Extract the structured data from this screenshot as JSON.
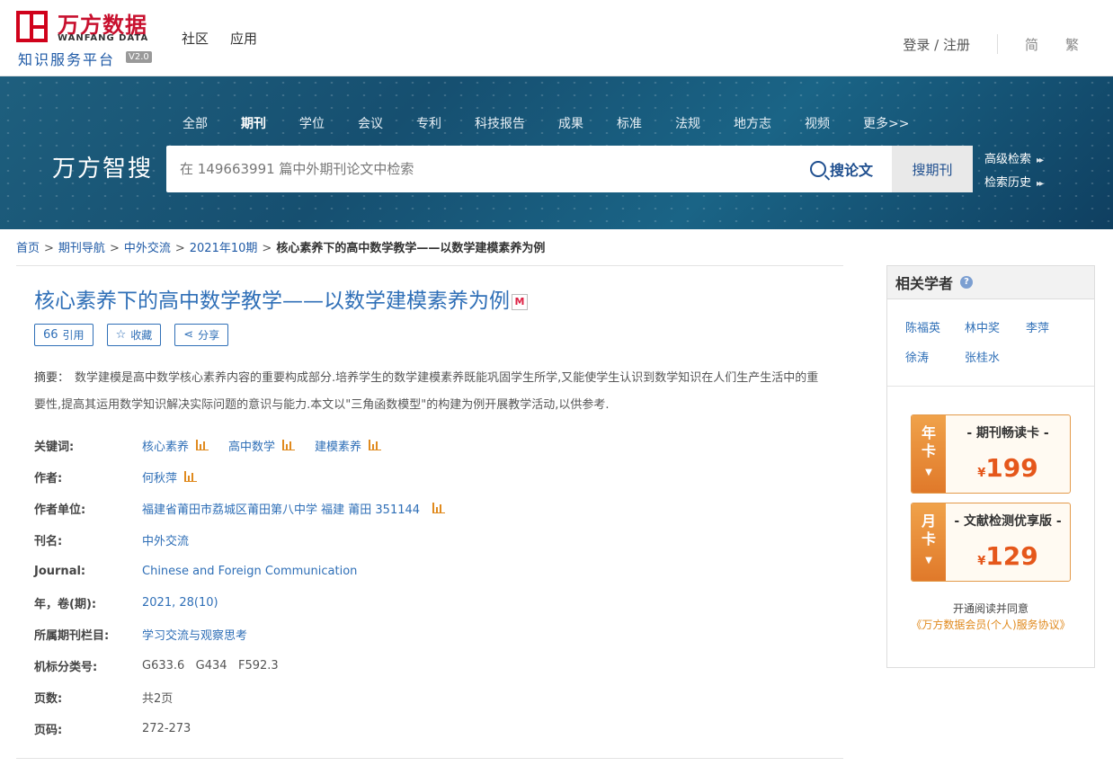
{
  "header": {
    "logo_cn": "万方数据",
    "logo_en": "WANFANG DATA",
    "logo_sub": "知识服务平台",
    "version": "V2.0",
    "nav": [
      "社区",
      "应用"
    ],
    "login": "登录 / 注册",
    "lang_simplified": "简",
    "lang_traditional": "繁"
  },
  "banner": {
    "categories": [
      "全部",
      "期刊",
      "学位",
      "会议",
      "专利",
      "科技报告",
      "成果",
      "标准",
      "法规",
      "地方志",
      "视频",
      "更多>>"
    ],
    "active_category": "期刊",
    "brand": "万方智搜",
    "search_placeholder": "在 149663991 篇中外期刊论文中检索",
    "search_paper": "搜论文",
    "search_journal": "搜期刊",
    "advanced": "高级检索",
    "history": "检索历史"
  },
  "breadcrumb": {
    "items": [
      "首页",
      "期刊导航",
      "中外交流",
      "2021年10期"
    ],
    "current": "核心素养下的高中数学教学——以数学建模素养为例"
  },
  "article": {
    "title": "核心素养下的高中数学教学——以数学建模素养为例",
    "title_badge": "M",
    "actions": {
      "cite": "引用",
      "collect": "收藏",
      "share": "分享"
    },
    "abstract_label": "摘要：",
    "abstract": "数学建模是高中数学核心素养内容的重要构成部分.培养学生的数学建模素养既能巩固学生所学,又能使学生认识到数学知识在人们生产生活中的重要性,提高其运用数学知识解决实际问题的意识与能力.本文以\"三角函数模型\"的构建为例开展教学活动,以供参考.",
    "fields": {
      "keywords_label": "关键词:",
      "keywords": [
        "核心素养",
        "高中数学",
        "建模素养"
      ],
      "author_label": "作者:",
      "author": "何秋萍",
      "affiliation_label": "作者单位:",
      "affiliation": "福建省莆田市荔城区莆田第八中学 福建 莆田 351144",
      "journal_cn_label": "刊名:",
      "journal_cn": "中外交流",
      "journal_en_label": "Journal:",
      "journal_en": "Chinese and Foreign Communication",
      "volume_label": "年，卷(期):",
      "volume": "2021, 28(10)",
      "column_label": "所属期刊栏目:",
      "column": "学习交流与观察思考",
      "classification_label": "机标分类号:",
      "classification": "G633.6   G434   F592.3",
      "pages_label": "页数:",
      "pages": "共2页",
      "page_range_label": "页码:",
      "page_range": "272-273"
    }
  },
  "sidebar": {
    "title": "相关学者",
    "help": "?",
    "scholars": [
      "陈福英",
      "林中奖",
      "李萍",
      "徐涛",
      "张桂水"
    ],
    "cards": [
      {
        "tag": "年卡",
        "name": "- 期刊畅读卡 -",
        "currency": "¥",
        "price": "199"
      },
      {
        "tag": "月卡",
        "name": "- 文献检测优享版 -",
        "currency": "¥",
        "price": "129"
      }
    ],
    "agree_text": "开通阅读并同意",
    "agree_link": "《万方数据会员(个人)服务协议》"
  },
  "colors": {
    "brand_red": "#c8102e",
    "link_blue": "#2f6fb7",
    "accent_orange": "#e5571b",
    "banner_blue": "#164f70"
  }
}
